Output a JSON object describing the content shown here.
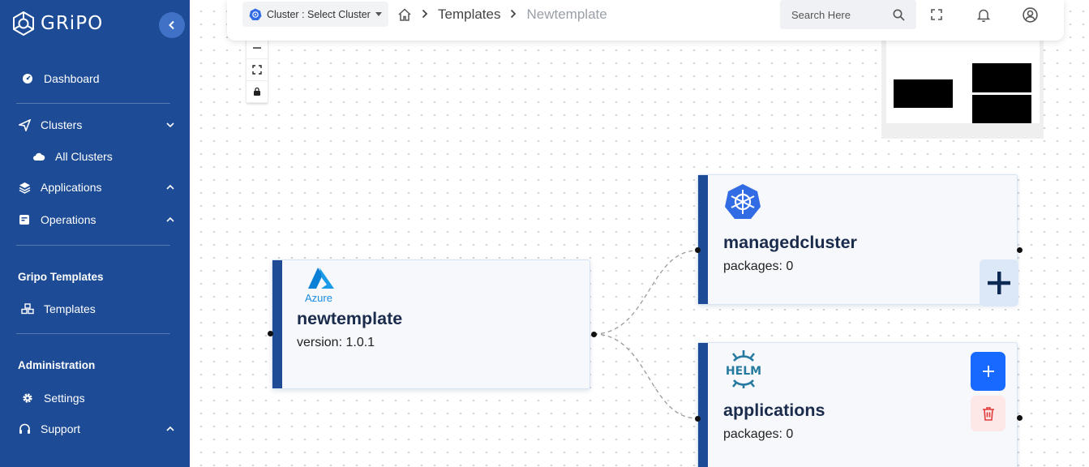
{
  "brand": {
    "name": "GRiPO"
  },
  "sidebar": {
    "dashboard": "Dashboard",
    "clusters": "Clusters",
    "all_clusters": "All Clusters",
    "applications": "Applications",
    "operations": "Operations",
    "templates_section": "Gripo Templates",
    "templates": "Templates",
    "admin_section": "Administration",
    "settings": "Settings",
    "support": "Support"
  },
  "topbar": {
    "cluster_select": "Cluster : Select Cluster",
    "breadcrumb": [
      "Templates",
      "Newtemplate"
    ],
    "search_placeholder": "Search Here"
  },
  "nodes": {
    "template": {
      "logo_text": "Azure",
      "title": "newtemplate",
      "subtitle": "version: 1.0.1"
    },
    "cluster": {
      "title": "managedcluster",
      "subtitle": "packages: 0"
    },
    "applications": {
      "logo_text": "HELM",
      "title": "applications",
      "subtitle": "packages: 0"
    }
  },
  "colors": {
    "sidebar": "#1d4b95",
    "accent": "#1769ff",
    "danger": "#e03b3b",
    "kubernetes": "#326ce5"
  }
}
